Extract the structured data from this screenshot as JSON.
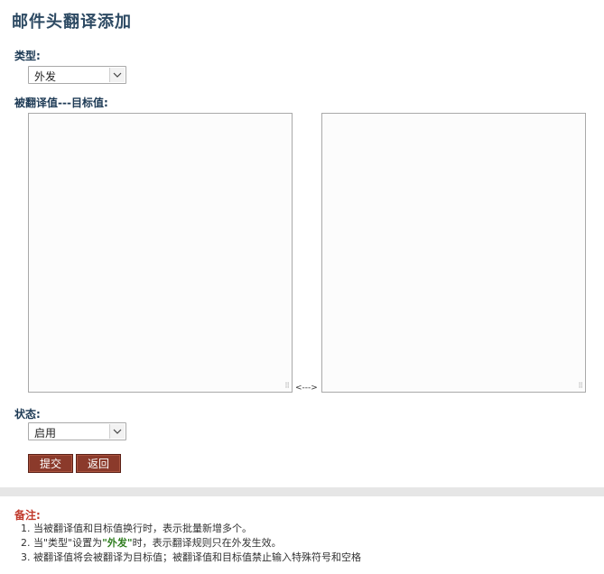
{
  "page": {
    "title": "邮件头翻译添加"
  },
  "form": {
    "type_label": "类型:",
    "type_value": "外发",
    "pairs_label": "被翻译值---目标值:",
    "source_value": "",
    "target_value": "",
    "separator": "<--->",
    "status_label": "状态:",
    "status_value": "启用",
    "submit_label": "提交",
    "back_label": "返回"
  },
  "notes": {
    "title": "备注:",
    "item1": "1. 当被翻译值和目标值换行时，表示批量新增多个。",
    "item2_prefix": "2. 当\"类型\"设置为",
    "item2_highlight": "\"外发\"",
    "item2_suffix": "时，表示翻译规则只在外发生效。",
    "item3": "3. 被翻译值将会被翻译为目标值；被翻译值和目标值禁止输入特殊符号和空格"
  },
  "colors": {
    "title": "#2d4a63",
    "button": "#8b3a2b",
    "notes_title": "#c0392b",
    "highlight": "#2e7d1e"
  }
}
